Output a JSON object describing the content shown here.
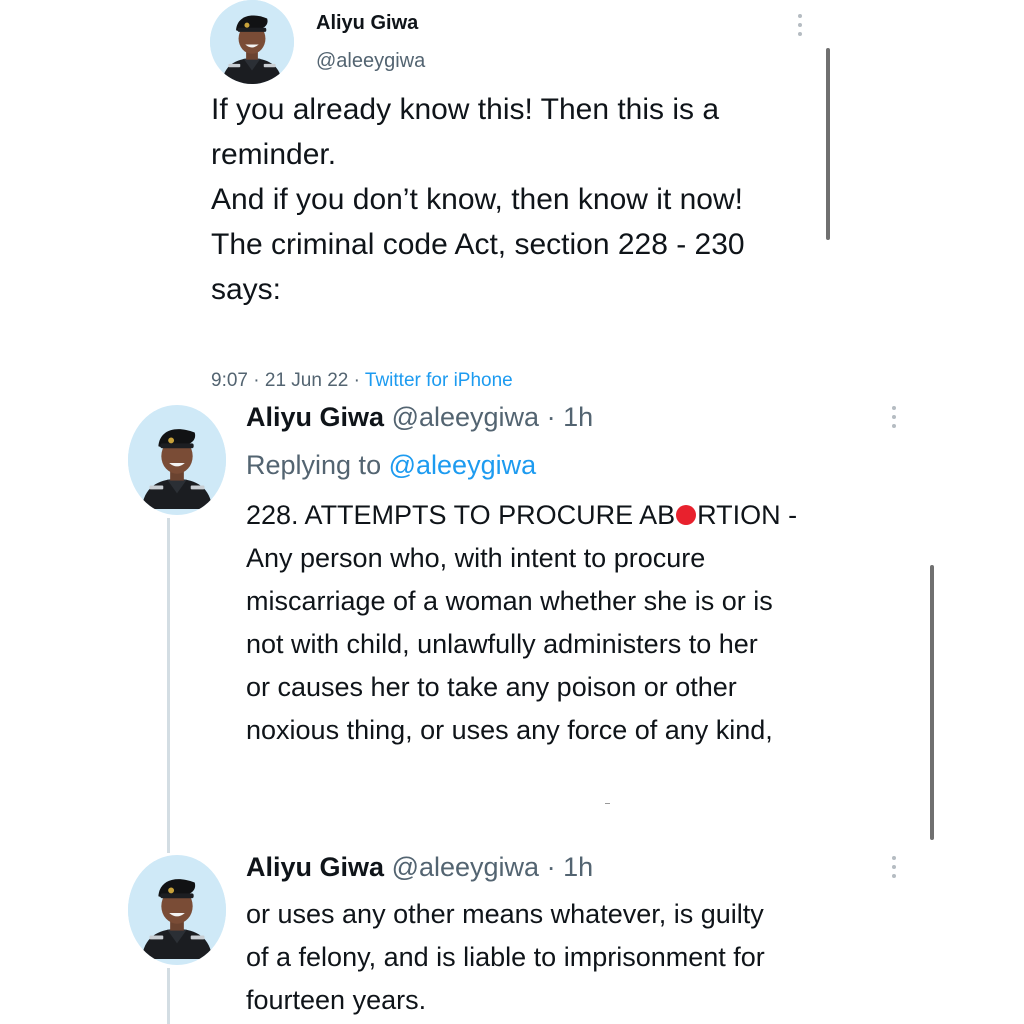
{
  "main_tweet": {
    "author_name": "Aliyu Giwa",
    "author_handle": "@aleeygiwa",
    "text_lines": [
      "If you already know this! Then this is a reminder.",
      "And if you don’t know, then know it now!",
      "The criminal code Act, section 228 - 230 says:"
    ],
    "time": "9:07",
    "date": "21 Jun 22",
    "source": "Twitter for iPhone",
    "separator": "·",
    "menu_icon": "more-vertical-icon"
  },
  "replies": [
    {
      "author_name": "Aliyu Giwa",
      "author_handle": "@aleeygiwa",
      "separator": "·",
      "age": "1h",
      "replying_label": "Replying to",
      "replying_handle": "@aleeygiwa",
      "text_before_dot": "228. ATTEMPTS TO PROCURE AB",
      "text_after_dot": "RTION -\nAny person who, with intent to procure\nmiscarriage of a woman whether she is or is\nnot with child, unlawfully administers to her\nor causes her to take any poison or other\nnoxious thing, or uses any force of any kind,",
      "recording_dot_color": "#e8212d",
      "menu_icon": "more-vertical-icon"
    },
    {
      "author_name": "Aliyu Giwa",
      "author_handle": "@aleeygiwa",
      "separator": "·",
      "age": "1h",
      "text": "or uses any other means whatever, is guilty\nof a felony, and is liable to imprisonment for\nfourteen years.",
      "menu_icon": "more-vertical-icon"
    }
  ],
  "colors": {
    "link": "#1d9bf0",
    "secondary_text": "#536471",
    "primary_text": "#0f1419",
    "avatar_background": "#cfe9f7"
  }
}
